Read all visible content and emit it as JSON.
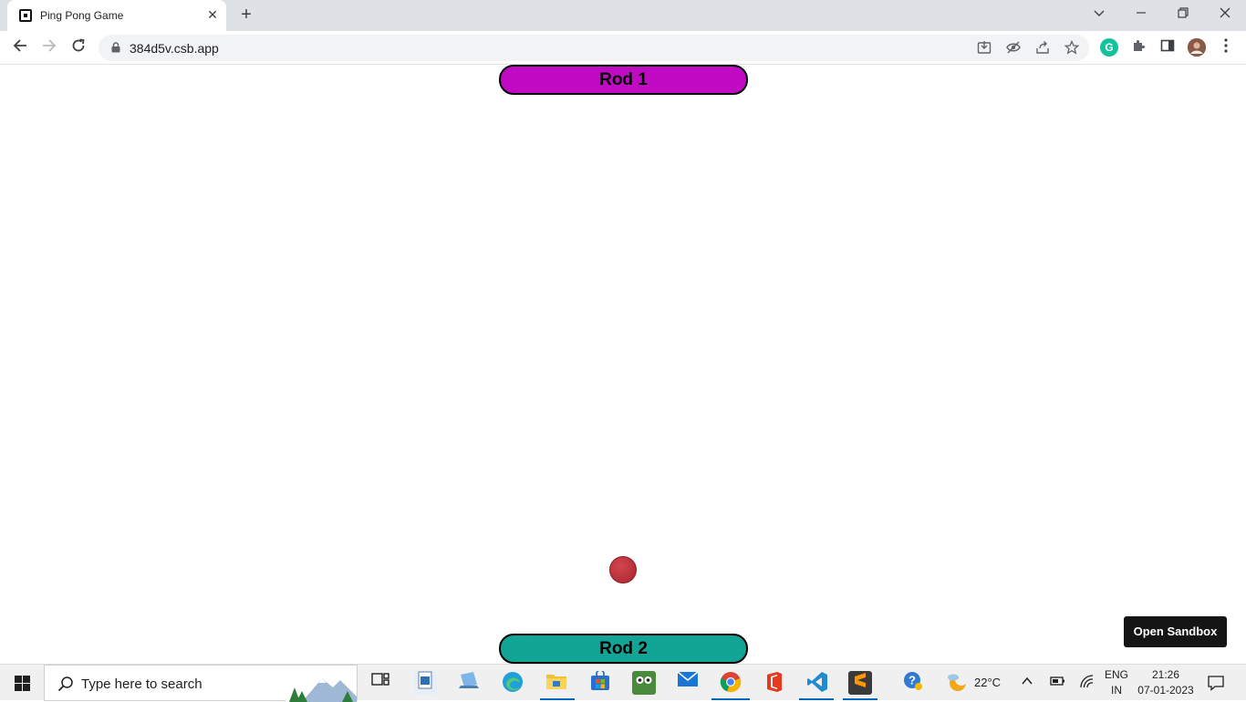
{
  "browser": {
    "tab_title": "Ping Pong Game",
    "url": "384d5v.csb.app"
  },
  "game": {
    "rod1_label": "Rod 1",
    "rod2_label": "Rod 2",
    "rod1_color": "#c00ac4",
    "rod2_color": "#12a596",
    "ball_color": "#c0353d"
  },
  "sandbox": {
    "open_label": "Open Sandbox"
  },
  "taskbar": {
    "search_placeholder": "Type here to search",
    "weather_temp": "22°C",
    "language": "ENG",
    "region": "IN",
    "time": "21:26",
    "date": "07-01-2023"
  }
}
